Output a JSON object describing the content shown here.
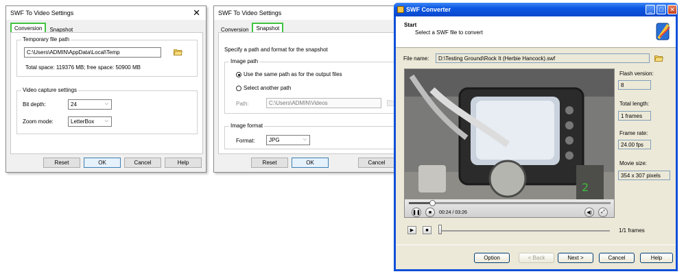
{
  "dialog1": {
    "title": "SWF To Video Settings",
    "tabs": [
      "Conversion",
      "Snapshot"
    ],
    "temp_group": "Temporary file path",
    "temp_path": "C:\\Users\\ADMIN\\AppData\\Local\\Temp",
    "space_info": "Total space: 119376 MB; free space: 50900 MB",
    "video_group": "Video capture settings",
    "bit_depth_label": "Bit depth:",
    "bit_depth_value": "24",
    "zoom_label": "Zoom mode:",
    "zoom_value": "LetterBox",
    "buttons": {
      "reset": "Reset",
      "ok": "OK",
      "cancel": "Cancel",
      "help": "Help"
    }
  },
  "dialog2": {
    "title": "SWF To Video Settings",
    "tabs": [
      "Conversion",
      "Snapshot"
    ],
    "intro": "Specify a path and format for the snapshot",
    "image_path_group": "Image path",
    "radio_same": "Use the same path as for the output files",
    "radio_other": "Select another path",
    "path_label": "Path:",
    "path_value": "C:\\Users\\ADMIN\\Videos",
    "image_format_group": "Image format",
    "format_label": "Format:",
    "format_value": "JPG",
    "buttons": {
      "reset": "Reset",
      "ok": "OK",
      "cancel": "Cancel"
    }
  },
  "converter": {
    "title": "SWF Converter",
    "step_title": "Start",
    "step_desc": "Select a SWF file to convert",
    "file_label": "File name:",
    "file_value": "D:\\Testing Ground\\Rock It (Herbie Hancock).swf",
    "flash_version_label": "Flash version:",
    "flash_version": "8",
    "total_length_label": "Total length:",
    "total_length": "1 frames",
    "frame_rate_label": "Frame rate:",
    "frame_rate": "24.00 fps",
    "movie_size_label": "Movie size:",
    "movie_size": "354 x 307 pixels",
    "time": "00:24 / 03:26",
    "playback_progress": 0.116,
    "frames": "1/1 frames",
    "buttons": {
      "option": "Option",
      "back": "< Back",
      "next": "Next >",
      "cancel": "Cancel",
      "help": "Help"
    }
  },
  "colors": {
    "highlight": "#3fc43f",
    "xp_blue": "#0b4fd9"
  }
}
